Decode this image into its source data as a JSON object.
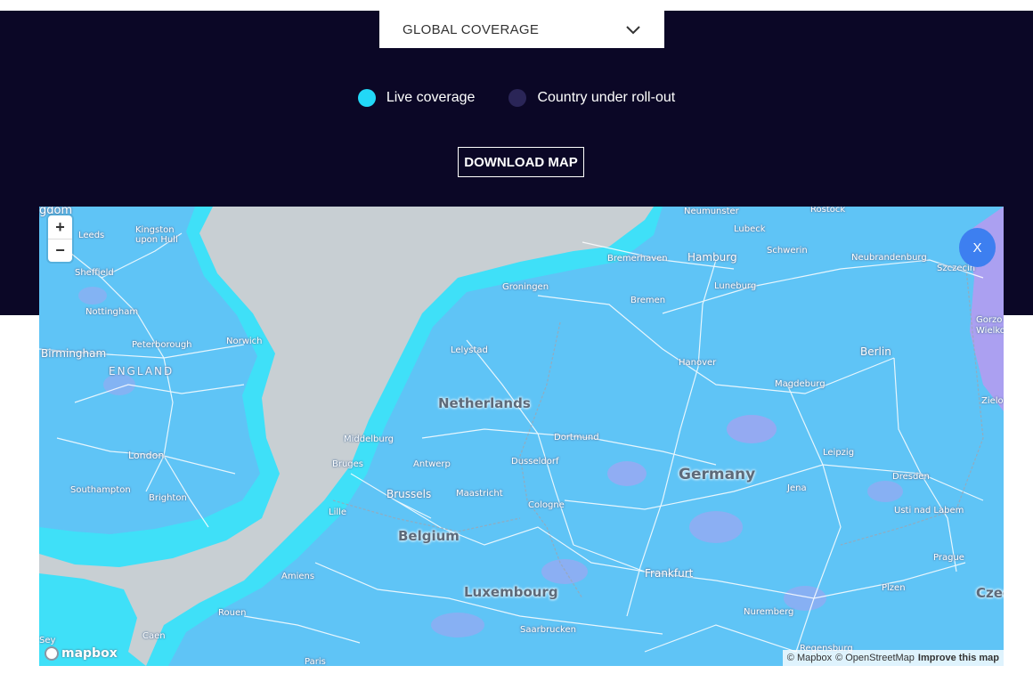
{
  "selector": {
    "value": "GLOBAL COVERAGE"
  },
  "legend": [
    {
      "label": "Live coverage",
      "color": "#22d8f7"
    },
    {
      "label": "Country under roll-out",
      "color": "#2a2557"
    }
  ],
  "download_label": "DOWNLOAD MAP",
  "colors": {
    "header_bg": "#0b0726",
    "land_coverage": "#5fc4f6",
    "coastal_coverage": "#3fe0f8",
    "sea": "#c8cfd3",
    "rollout_overlay": "#b89af0",
    "close_button": "#3d7ff0"
  },
  "map": {
    "zoom_in": "+",
    "zoom_out": "−",
    "close_label": "X",
    "countries": [
      "Netherlands",
      "Germany",
      "Belgium",
      "Luxembourg",
      "Czec"
    ],
    "regions": [
      "ENGLAND"
    ],
    "cities": [
      "gdom",
      "Leeds",
      "Kingston upon Hull",
      "Sheffield",
      "Nottingham",
      "Peterborough",
      "Norwich",
      "Birmingham",
      "London",
      "Southampton",
      "Brighton",
      "Neumunster",
      "Rostock",
      "Lubeck",
      "Schwerin",
      "Neubrandenburg",
      "Szczecin",
      "Bremerhaven",
      "Hamburg",
      "Luneburg",
      "Groningen",
      "Bremen",
      "Gorzo Wielkop",
      "Lelystad",
      "Hanover",
      "Berlin",
      "Magdeburg",
      "Zielo",
      "Middelburg",
      "Dortmund",
      "Bruges",
      "Antwerp",
      "Dusseldorf",
      "Leipzig",
      "Brussels",
      "Maastricht",
      "Dresden",
      "Jena",
      "Cologne",
      "Lille",
      "Usti nad Labem",
      "Amiens",
      "Prague",
      "Frankfurt",
      "Plzen",
      "Rouen",
      "Nuremberg",
      "Caen",
      "Saarbrucken",
      "Paris",
      "Regensburg",
      "Sey"
    ],
    "logo": "mapbox",
    "attribution": [
      "© Mapbox",
      "© OpenStreetMap"
    ],
    "improve_link": "Improve this map"
  }
}
